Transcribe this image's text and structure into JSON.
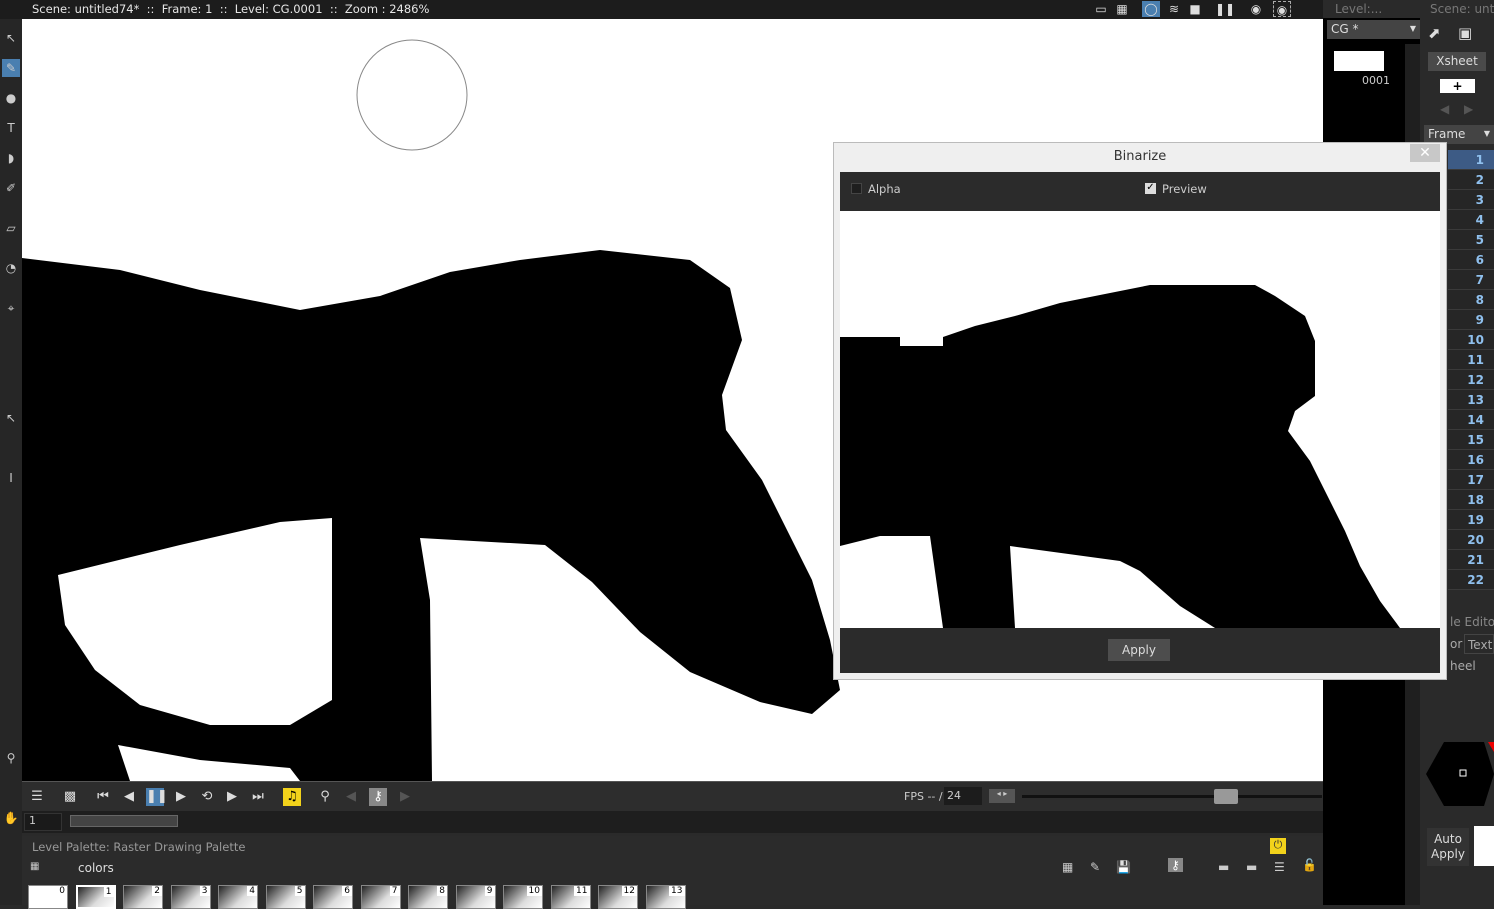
{
  "statusbar": {
    "text": "Scene: untitled74*  ::  Frame: 1  ::  Level: CG.0001  ::  Zoom : 2486%"
  },
  "viewer_icons": [
    "safe-area-icon",
    "grid-icon",
    "camera-stand-icon",
    "onion-skin-icon",
    "camera-icon",
    "freeze-icon",
    "preview-icon",
    "sub-camera-preview-icon"
  ],
  "playback": {
    "frame_value": "1",
    "fps_label": "FPS -- / ",
    "fps_value": "24"
  },
  "palette": {
    "title": "Level Palette: Raster Drawing Palette",
    "tab": "colors",
    "chips": [
      "0",
      "1",
      "2",
      "3",
      "4",
      "5",
      "6",
      "7",
      "8",
      "9",
      "10",
      "11",
      "12",
      "13"
    ]
  },
  "level_strip": {
    "title": "Level:...",
    "level_select": "CG *",
    "frame": "0001"
  },
  "xsheet": {
    "title": "Scene: untit",
    "xsheet_button": "Xsheet",
    "frame_select": "Frame",
    "frames": [
      "1",
      "2",
      "3",
      "4",
      "5",
      "6",
      "7",
      "8",
      "9",
      "10",
      "11",
      "12",
      "13",
      "14",
      "15",
      "16",
      "17",
      "18",
      "19",
      "20",
      "21",
      "22"
    ],
    "style_editor_title": "le Editor",
    "tabs": [
      "or",
      "Textu"
    ],
    "wheel_tab": "heel",
    "auto_apply": "Auto Apply"
  },
  "dialog": {
    "title": "Binarize",
    "alpha_label": "Alpha",
    "alpha_checked": false,
    "preview_label": "Preview",
    "preview_checked": true,
    "apply": "Apply"
  },
  "colors": {
    "accent": "#4a7fb0",
    "highlight": "#f2d21b",
    "frame_number": "#8fc0ee"
  }
}
